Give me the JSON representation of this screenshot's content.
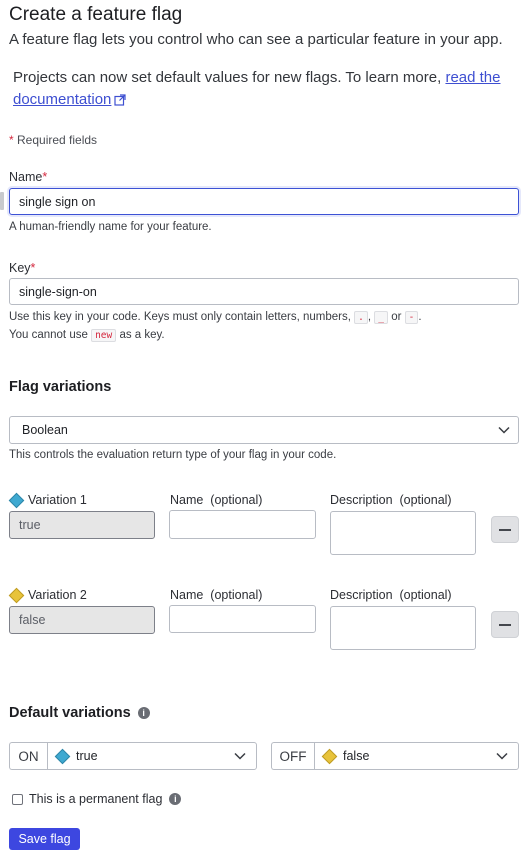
{
  "header": {
    "title": "Create a feature flag",
    "subtitle": "A feature flag lets you control who can see a particular feature in your app."
  },
  "banner": {
    "text": "Projects can now set default values for new flags. To learn more, ",
    "link_label": "read the documentation"
  },
  "required_note": {
    "asterisk": "*",
    "text": " Required fields"
  },
  "name_field": {
    "label": "Name",
    "required_mark": "*",
    "value": "single sign on",
    "hint": "A human-friendly name for your feature."
  },
  "key_field": {
    "label": "Key",
    "required_mark": "*",
    "value": "single-sign-on",
    "hint_prefix": "Use this key in your code. Keys must only contain letters, numbers,",
    "chars": [
      ".",
      "_",
      "-"
    ],
    "hint_or": "or",
    "hint2_prefix": "You cannot use",
    "reserved_word": "new",
    "hint2_suffix": "as a key."
  },
  "variations_section": {
    "title": "Flag variations",
    "type_value": "Boolean",
    "type_hint": "This controls the evaluation return type of your flag in your code.",
    "name_label": "Name",
    "description_label": "Description",
    "optional_suffix": "(optional)",
    "items": [
      {
        "label": "Variation 1",
        "value": "true",
        "name_value": "",
        "description_value": "",
        "color": "#3fa9d1",
        "icon": "diamond-icon"
      },
      {
        "label": "Variation 2",
        "value": "false",
        "name_value": "",
        "description_value": "",
        "color": "#e8c33a",
        "icon": "diamond-icon"
      }
    ]
  },
  "defaults_section": {
    "title": "Default variations",
    "on_label": "ON",
    "on_value": "true",
    "off_label": "OFF",
    "off_value": "false"
  },
  "permanent_checkbox": {
    "label": "This is a permanent flag",
    "checked": false
  },
  "actions": {
    "save_label": "Save flag"
  },
  "colors": {
    "primary": "#3d47e0",
    "link": "#3e4fd1",
    "required": "#d4283e",
    "variation_true": "#3fa9d1",
    "variation_false": "#e8c33a"
  }
}
